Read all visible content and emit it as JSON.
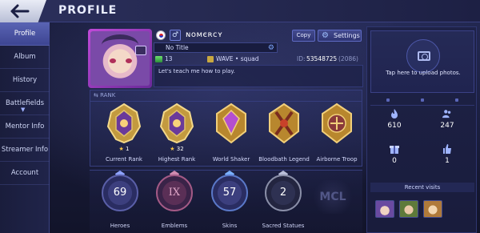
{
  "header": {
    "title": "PROFILE"
  },
  "sidebar": {
    "items": [
      {
        "label": "Profile",
        "active": true
      },
      {
        "label": "Album"
      },
      {
        "label": "History"
      },
      {
        "label": "Battlefields"
      },
      {
        "label": "Mentor Info"
      },
      {
        "label": "Streamer Info"
      },
      {
        "label": "Account"
      }
    ]
  },
  "profile": {
    "name": "ɴᴏᴍєʀᴄʏ",
    "title": "No Title",
    "level": "13",
    "squad": "WAVE • squad",
    "id_label": "ID:",
    "id": "53548725",
    "id_sub": "(2086)",
    "bio": "Let's teach me how to play.",
    "copy_label": "Copy",
    "settings_label": "Settings"
  },
  "rank": {
    "header": "RANK",
    "medals": [
      {
        "label": "Current Rank",
        "stars": "1"
      },
      {
        "label": "Highest Rank",
        "stars": "32"
      },
      {
        "label": "World Shaker"
      },
      {
        "label": "Bloodbath Legend"
      },
      {
        "label": "Airborne Troop"
      }
    ]
  },
  "stats": [
    {
      "label": "Heroes",
      "value": "69"
    },
    {
      "label": "Emblems",
      "value": "IX"
    },
    {
      "label": "Skins",
      "value": "57"
    },
    {
      "label": "Sacred Statues",
      "value": "2"
    }
  ],
  "mcl_logo": "MCL",
  "right_panel": {
    "upload_text": "Tap here to upload photos.",
    "stats": [
      {
        "icon": "flame-icon",
        "value": "610"
      },
      {
        "icon": "followers-icon",
        "value": "247"
      },
      {
        "icon": "gift-icon",
        "value": "0"
      },
      {
        "icon": "thumbs-up-icon",
        "value": "1"
      }
    ],
    "recent_label": "Recent visits"
  },
  "colors": {
    "accent": "#5a64b4",
    "gold": "#f3c54a",
    "background": "#14172e"
  }
}
